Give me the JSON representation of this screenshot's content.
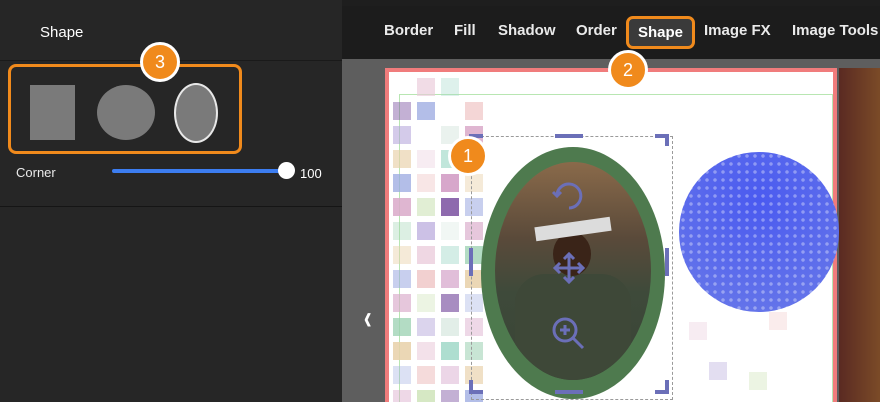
{
  "panel": {
    "title": "Shape",
    "corner_label": "Corner",
    "corner_value": "100",
    "corner_level": 1.0,
    "shapes": [
      "square",
      "circle",
      "oval"
    ],
    "selected_shape": "oval"
  },
  "toolbar": {
    "tabs": [
      "Border",
      "Fill",
      "Shadow",
      "Order",
      "Shape",
      "Image FX",
      "Image Tools"
    ],
    "active_tab": "Shape"
  },
  "badges": [
    "1",
    "2",
    "3"
  ],
  "icons": {
    "prev": "chevron-left-icon",
    "rotate": "rotate-icon",
    "move": "move-icon",
    "zoom": "zoom-icon"
  },
  "colors": {
    "accent": "#f08a1c",
    "slider": "#3c7df0",
    "frame": "#4e7a4e",
    "handles": "#6b6fb8",
    "halftone": "#4a5af0",
    "page_border": "#f07c7c"
  }
}
